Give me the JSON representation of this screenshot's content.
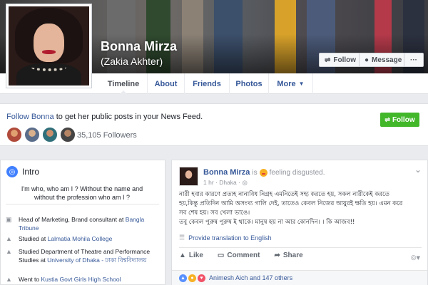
{
  "profile": {
    "name": "Bonna Mirza",
    "alternate_name": "(Zakia Akhter)"
  },
  "cover_actions": {
    "follow_label": "Follow",
    "message_label": "Message",
    "more_label": "···"
  },
  "tabs": [
    {
      "label": "Timeline",
      "active": true
    },
    {
      "label": "About"
    },
    {
      "label": "Friends"
    },
    {
      "label": "Photos"
    },
    {
      "label": "More"
    }
  ],
  "follow_prompt": {
    "prefix": "Follow ",
    "name_link": "Bonna",
    "suffix": " to get her public posts in your News Feed.",
    "button_label": "Follow",
    "followers_text": "35,105 Followers"
  },
  "intro": {
    "title": "Intro",
    "bio": "I'm who, who am I ? Without the name and without the profession who am I ?",
    "items": [
      {
        "icon": "briefcase-icon",
        "text": "Head of Marketing, Brand consultant at ",
        "link": "Bangla Tribune"
      },
      {
        "icon": "graduation-cap-icon",
        "text": "Studied at ",
        "link": "Lalmatia Mohila College"
      },
      {
        "icon": "graduation-cap-icon",
        "text": "Studied Department of Theatre and Performance Studies at ",
        "link": "University of Dhaka - ঢাকা বিশ্ববিদ্যালয়"
      },
      {
        "icon": "graduation-cap-icon",
        "text": "Went to ",
        "link": "Kustia Govt Girls High School"
      }
    ]
  },
  "post": {
    "author": "Bonna Mirza",
    "is_text": "is",
    "feeling": "feeling disgusted.",
    "time": "1 hr · Dhaka · ",
    "body_line1": "নারী হবার কারণে প্রত্যহ নানাবিধ নিগ্রহ এমনিতেই সহ্য করতে হয়, সকল নারীকেই করতে",
    "body_line2": "হয়,কিন্তু প্রতিদিন আমি অসংখ্য গালি দেই, তাতেও কেবল নিজের আয়ুরই ক্ষতি হয়। এমন করে",
    "body_line3": "সব শেষ হয়। সব খেলা ভাঙে।",
    "body_line4": "তবু কেবল পুরুষ পুরুষ ই থাকে। মানুষ হয় না আর কোনদিন। । কি আজব!!",
    "translate_label": "Provide translation to English",
    "like_label": "Like",
    "comment_label": "Comment",
    "share_label": "Share",
    "reactions_text": "Animesh Aich and 147 others"
  },
  "colors": {
    "link": "#365899",
    "follow_green": "#42b72a",
    "background": "#e9ebee"
  }
}
